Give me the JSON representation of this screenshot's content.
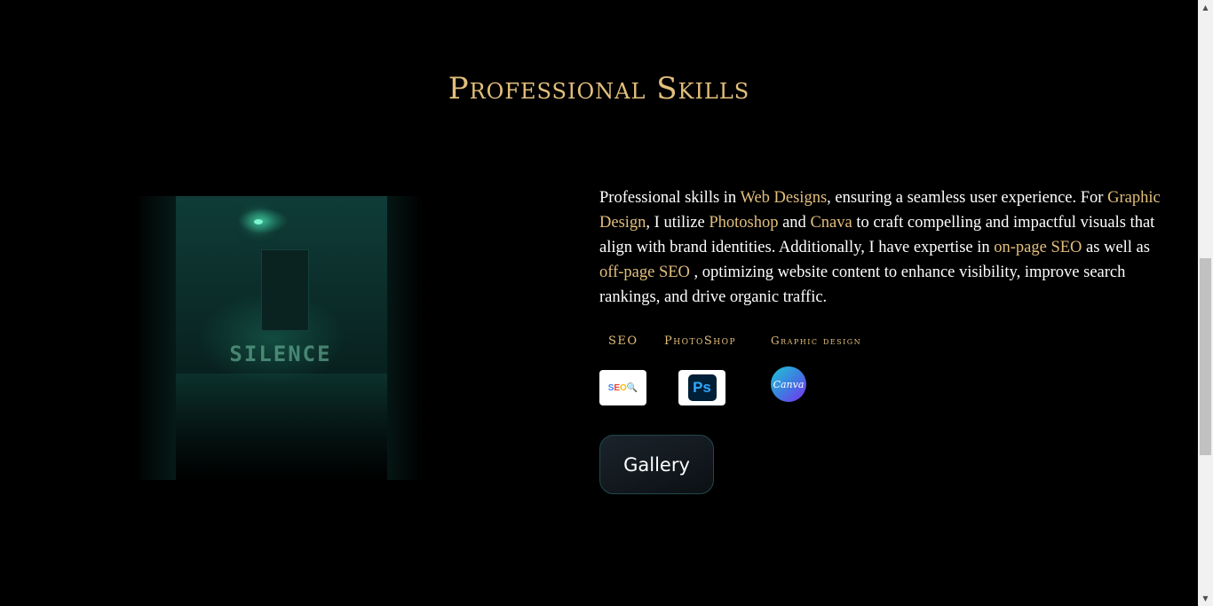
{
  "section": {
    "title": "Professional Skills"
  },
  "photo": {
    "floor_text": "SILENCE"
  },
  "description": {
    "p1": "Professional skills in ",
    "h1": "Web Designs",
    "p2": ", ensuring a seamless user experience. For ",
    "h2": "Graphic Design",
    "p3": ", I utilize ",
    "h3": "Photoshop",
    "p4": " and ",
    "h4": "Cnava",
    "p5": " to craft compelling and impactful visuals that align with brand identities. Additionally, I have expertise in ",
    "h5": "on-page SEO",
    "p6": " as well as ",
    "h6": "off-page SEO",
    "p7": " , optimizing website content to enhance visibility, improve search rankings, and drive organic traffic."
  },
  "skills": [
    {
      "label": "SEO",
      "logo_text": "SEO",
      "icon": "seo-icon"
    },
    {
      "label": "PhotoShop",
      "logo_text": "Ps",
      "icon": "photoshop-icon"
    },
    {
      "label": "Graphic design",
      "logo_text": "Canva",
      "icon": "canva-icon"
    }
  ],
  "gallery_button": {
    "label": "Gallery"
  },
  "colors": {
    "accent": "#e3bf7c",
    "background": "#000000",
    "text": "#ffffff"
  }
}
